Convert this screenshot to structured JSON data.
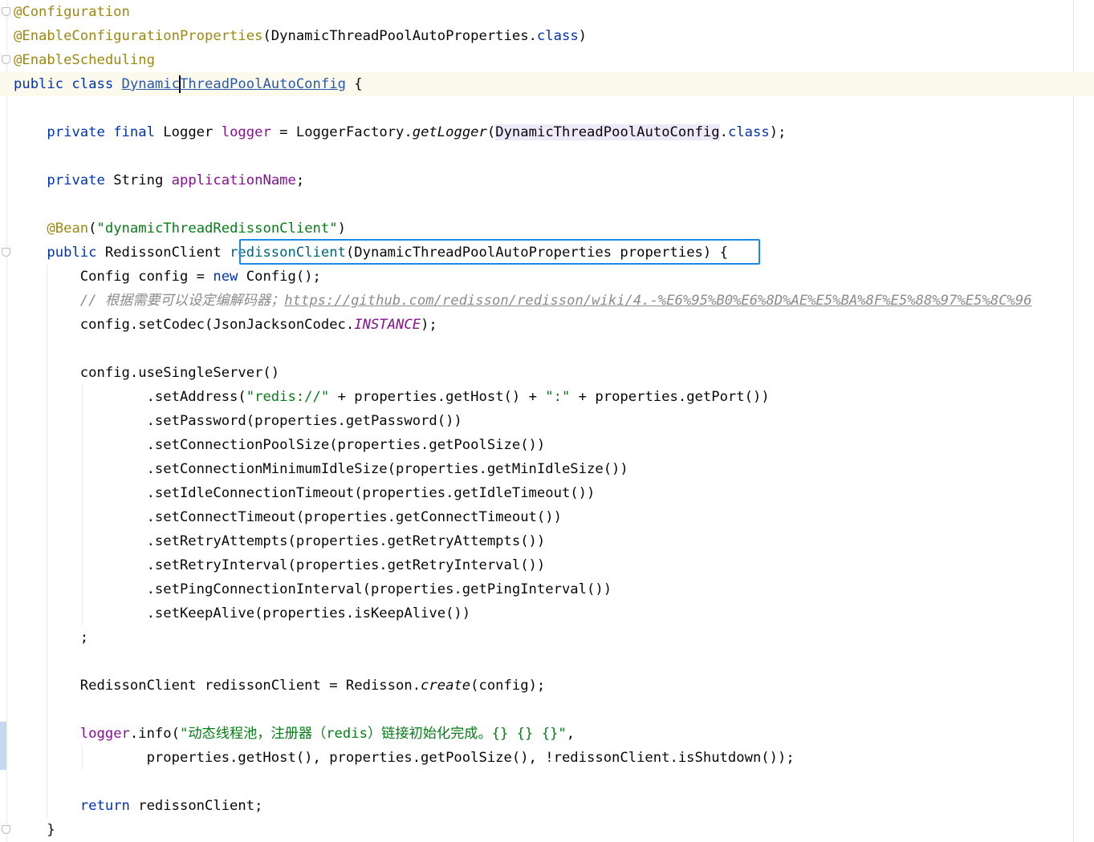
{
  "editor": {
    "lines": [
      [
        {
          "text": "@Configuration",
          "kind": "annotation"
        }
      ],
      [
        {
          "text": "@EnableConfigurationProperties",
          "kind": "annotation"
        },
        {
          "text": "(DynamicThreadPoolAutoProperties.",
          "kind": "plain"
        },
        {
          "text": "class",
          "kind": "keyword"
        },
        {
          "text": ")",
          "kind": "plain"
        }
      ],
      [
        {
          "text": "@EnableScheduling",
          "kind": "annotation"
        }
      ],
      [
        {
          "text": "public class ",
          "kind": "keyword"
        },
        {
          "text": "Dynamic",
          "kind": "classref"
        },
        {
          "text": "|",
          "kind": "caret"
        },
        {
          "text": "ThreadPoolAutoConfig",
          "kind": "classref"
        },
        {
          "text": " {",
          "kind": "plain"
        }
      ],
      [],
      [
        {
          "text": "    ",
          "kind": "plain"
        },
        {
          "text": "private final ",
          "kind": "keyword"
        },
        {
          "text": "Logger ",
          "kind": "plain"
        },
        {
          "text": "logger",
          "kind": "field"
        },
        {
          "text": " = LoggerFactory.",
          "kind": "plain"
        },
        {
          "text": "getLogger",
          "kind": "static-method"
        },
        {
          "text": "(",
          "kind": "plain"
        },
        {
          "text": "DynamicThreadPoolAutoConfig",
          "kind": "plain-hl"
        },
        {
          "text": ".",
          "kind": "plain"
        },
        {
          "text": "class",
          "kind": "keyword"
        },
        {
          "text": ");",
          "kind": "plain"
        }
      ],
      [],
      [
        {
          "text": "    ",
          "kind": "plain"
        },
        {
          "text": "private ",
          "kind": "keyword"
        },
        {
          "text": "String ",
          "kind": "plain"
        },
        {
          "text": "applicationName",
          "kind": "field"
        },
        {
          "text": ";",
          "kind": "plain"
        }
      ],
      [],
      [
        {
          "text": "    ",
          "kind": "plain"
        },
        {
          "text": "@Bean",
          "kind": "annotation"
        },
        {
          "text": "(",
          "kind": "plain"
        },
        {
          "text": "\"dynamicThreadRedissonClient\"",
          "kind": "string"
        },
        {
          "text": ")",
          "kind": "plain"
        }
      ],
      [
        {
          "text": "    ",
          "kind": "plain"
        },
        {
          "text": "public ",
          "kind": "keyword"
        },
        {
          "text": "RedissonClient ",
          "kind": "plain"
        },
        {
          "text": "redissonClient",
          "kind": "method-decl"
        },
        {
          "text": "(DynamicThreadPoolAutoProperties properties) {",
          "kind": "plain"
        }
      ],
      [
        {
          "text": "        Config config = ",
          "kind": "plain"
        },
        {
          "text": "new ",
          "kind": "keyword"
        },
        {
          "text": "Config();",
          "kind": "plain"
        }
      ],
      [
        {
          "text": "        ",
          "kind": "plain"
        },
        {
          "text": "// 根据需要可以设定编解码器；",
          "kind": "comment"
        },
        {
          "text": "https://github.com/redisson/redisson/wiki/4.-%E6%95%B0%E6%8D%AE%E5%BA%8F%E5%88%97%E5%8C%96",
          "kind": "link"
        }
      ],
      [
        {
          "text": "        config.setCodec(JsonJacksonCodec.",
          "kind": "plain"
        },
        {
          "text": "INSTANCE",
          "kind": "static-field"
        },
        {
          "text": ");",
          "kind": "plain"
        }
      ],
      [],
      [
        {
          "text": "        config.useSingleServer()",
          "kind": "plain"
        }
      ],
      [
        {
          "text": "                .setAddress(",
          "kind": "plain"
        },
        {
          "text": "\"redis://\"",
          "kind": "string"
        },
        {
          "text": " + properties.getHost() + ",
          "kind": "plain"
        },
        {
          "text": "\":\"",
          "kind": "string"
        },
        {
          "text": " + properties.getPort())",
          "kind": "plain"
        }
      ],
      [
        {
          "text": "                .setPassword(properties.getPassword())",
          "kind": "plain"
        }
      ],
      [
        {
          "text": "                .setConnectionPoolSize(properties.getPoolSize())",
          "kind": "plain"
        }
      ],
      [
        {
          "text": "                .setConnectionMinimumIdleSize(properties.getMinIdleSize())",
          "kind": "plain"
        }
      ],
      [
        {
          "text": "                .setIdleConnectionTimeout(properties.getIdleTimeout())",
          "kind": "plain"
        }
      ],
      [
        {
          "text": "                .setConnectTimeout(properties.getConnectTimeout())",
          "kind": "plain"
        }
      ],
      [
        {
          "text": "                .setRetryAttempts(properties.getRetryAttempts())",
          "kind": "plain"
        }
      ],
      [
        {
          "text": "                .setRetryInterval(properties.getRetryInterval())",
          "kind": "plain"
        }
      ],
      [
        {
          "text": "                .setPingConnectionInterval(properties.getPingInterval())",
          "kind": "plain"
        }
      ],
      [
        {
          "text": "                .setKeepAlive(properties.isKeepAlive())",
          "kind": "plain"
        }
      ],
      [
        {
          "text": "        ;",
          "kind": "plain"
        }
      ],
      [],
      [
        {
          "text": "        RedissonClient redissonClient = Redisson.",
          "kind": "plain"
        },
        {
          "text": "create",
          "kind": "static-method"
        },
        {
          "text": "(config);",
          "kind": "plain"
        }
      ],
      [],
      [
        {
          "text": "        ",
          "kind": "plain"
        },
        {
          "text": "logger",
          "kind": "field"
        },
        {
          "text": ".info(",
          "kind": "plain"
        },
        {
          "text": "\"动态线程池，注册器（redis）链接初始化完成。{} {} {}\"",
          "kind": "string"
        },
        {
          "text": ",",
          "kind": "plain"
        }
      ],
      [
        {
          "text": "                properties.getHost(), properties.getPoolSize(), !redissonClient.isShutdown());",
          "kind": "plain"
        }
      ],
      [],
      [
        {
          "text": "        ",
          "kind": "plain"
        },
        {
          "text": "return ",
          "kind": "keyword"
        },
        {
          "text": "redissonClient;",
          "kind": "plain"
        }
      ],
      [
        {
          "text": "    }",
          "kind": "plain"
        }
      ]
    ]
  },
  "colors": {
    "annotation": "#9e880d",
    "keyword": "#0033b3",
    "field": "#871094",
    "string": "#067d17",
    "comment": "#8c8c8c",
    "selection_border": "#1a8ae6",
    "current_line": "#fcfaed"
  },
  "icons": [
    "fold-marker-icon"
  ]
}
